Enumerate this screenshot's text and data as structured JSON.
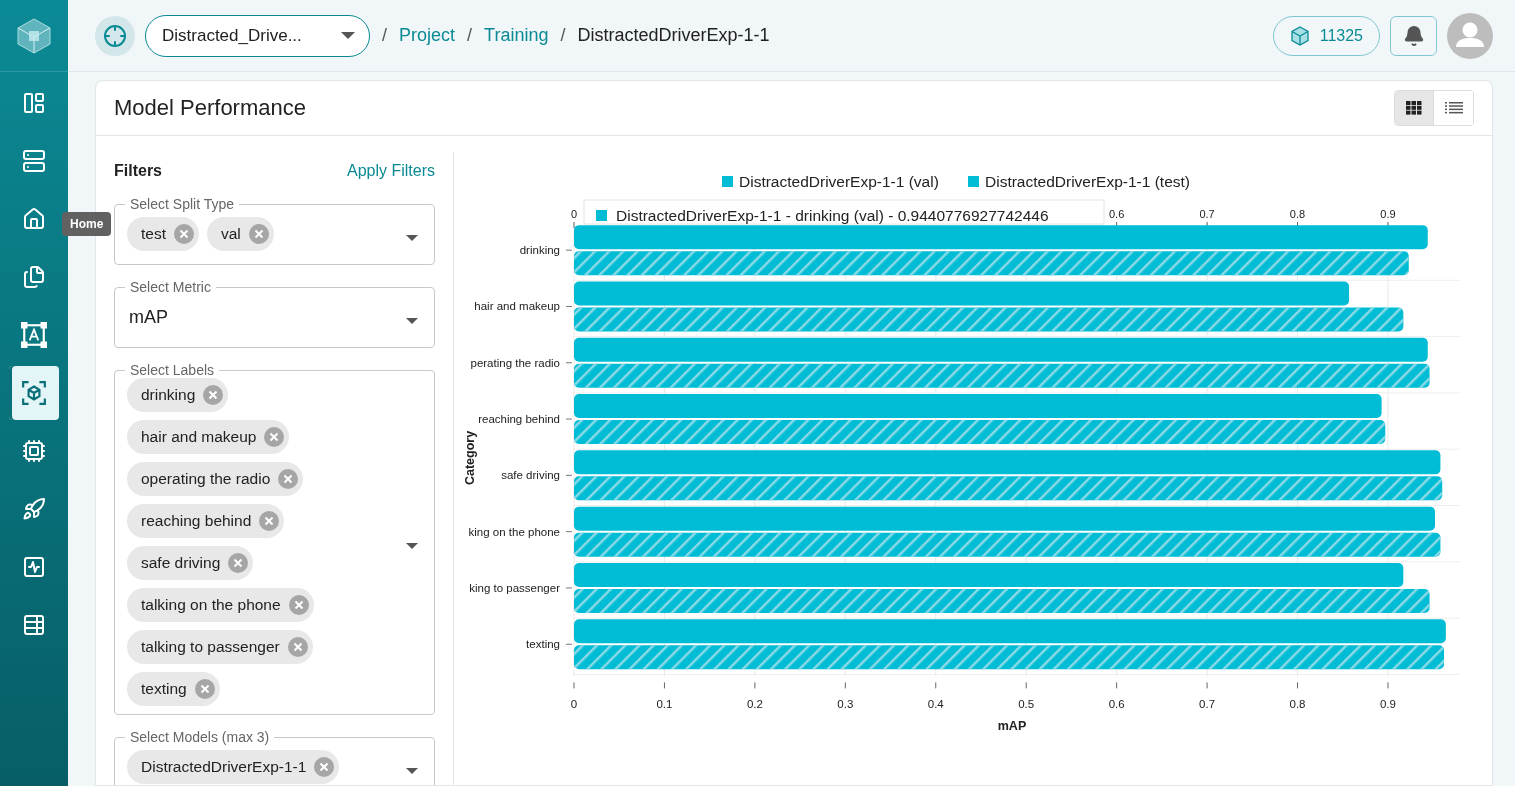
{
  "sidebar": {
    "items": [
      {
        "selected": false
      },
      {
        "selected": false
      },
      {
        "selected": false
      },
      {
        "selected": false
      },
      {
        "selected": false
      },
      {
        "selected": true
      },
      {
        "selected": false
      },
      {
        "selected": false
      },
      {
        "selected": false
      },
      {
        "selected": false
      }
    ],
    "tooltip": "Home"
  },
  "topbar": {
    "project_select": "Distracted_Drive...",
    "breadcrumbs": [
      {
        "separator": "/",
        "label": "Project",
        "link": true
      },
      {
        "separator": "/",
        "label": "Training",
        "link": true
      },
      {
        "separator": "/",
        "label": "DistractedDriverExp-1-1",
        "link": false
      }
    ],
    "credits": "11325"
  },
  "page": {
    "title": "Model Performance",
    "views": [
      {
        "kind": "grid",
        "selected": true
      },
      {
        "kind": "list",
        "selected": false
      }
    ]
  },
  "filters": {
    "title": "Filters",
    "action": "Apply Filters",
    "fields": [
      {
        "label": "Select Split Type",
        "kind": "chips",
        "chips": [
          "test",
          "val"
        ]
      },
      {
        "label": "Select Metric",
        "kind": "value",
        "value": "mAP"
      },
      {
        "label": "Select Labels",
        "kind": "chips",
        "chips": [
          "drinking",
          "hair and makeup",
          "operating the radio",
          "reaching behind",
          "safe driving",
          "talking on the phone",
          "talking to passenger",
          "texting"
        ]
      },
      {
        "label": "Select Models (max 3)",
        "kind": "chips",
        "chips": [
          "DistractedDriverExp-1-1"
        ]
      }
    ]
  },
  "chart": {
    "tooltip": "DistractedDriverExp-1-1 - drinking (val) - 0.9440776927742446",
    "top_xticks": [
      "0",
      "0.6",
      "0.7",
      "0.8",
      "0.9"
    ],
    "chart_data": {
      "type": "bar",
      "orientation": "horizontal",
      "xlabel": "mAP",
      "ylabel": "Category",
      "categories": [
        "drinking",
        "hair and makeup",
        "perating the radio",
        "reaching behind",
        "safe driving",
        "king on the phone",
        "king to passenger",
        "texting"
      ],
      "series": [
        {
          "name": "DistractedDriverExp-1-1 (val)",
          "color": "#00bcd4",
          "values": [
            0.944,
            0.857,
            0.944,
            0.893,
            0.958,
            0.952,
            0.917,
            0.964
          ]
        },
        {
          "name": "DistractedDriverExp-1-1 (test)",
          "color": "#00bcd4",
          "values": [
            0.923,
            0.917,
            0.946,
            0.897,
            0.96,
            0.958,
            0.946,
            0.962
          ]
        }
      ],
      "xlim": [
        0,
        0.98
      ],
      "grid": true,
      "legend": "top",
      "xticks": [
        0,
        0.1,
        0.2,
        0.3,
        0.4,
        0.5,
        0.6,
        0.7,
        0.8,
        0.9
      ]
    }
  }
}
